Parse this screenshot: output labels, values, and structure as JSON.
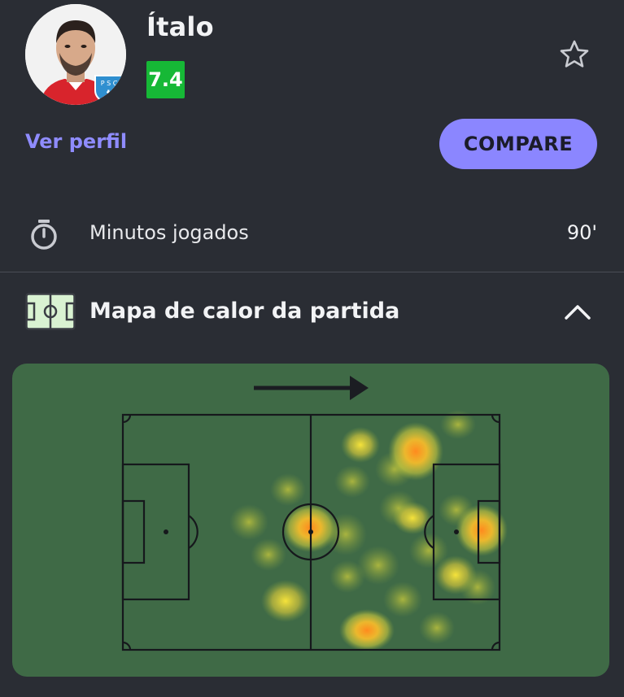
{
  "player": {
    "name": "Ítalo",
    "rating": "7.4",
    "profile_link": "Ver perfil",
    "compare_label": "COMPARE",
    "team_badge_text": "P S C"
  },
  "stats": {
    "minutes_label": "Minutos jogados",
    "minutes_value": "90'"
  },
  "heatmap": {
    "title": "Mapa de calor da partida",
    "direction": "attacking-right"
  },
  "colors": {
    "background": "#2a2d34",
    "accent": "#8b86ff",
    "rating_green": "#16b836",
    "pitch_green": "#3f6a46"
  },
  "icons": {
    "favorite": "star-outline-icon",
    "minutes": "stopwatch-icon",
    "section": "pitch-icon",
    "collapse": "chevron-up-icon"
  }
}
